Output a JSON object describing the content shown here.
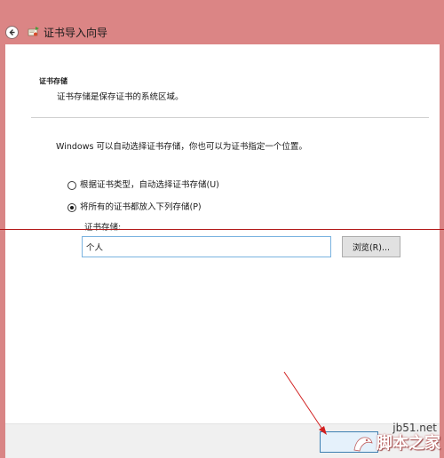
{
  "window": {
    "title": "证书导入向导"
  },
  "section": {
    "title": "证书存储",
    "description": "证书存储是保存证书的系统区域。"
  },
  "info": {
    "text": "Windows 可以自动选择证书存储，你也可以为证书指定一个位置。"
  },
  "options": [
    {
      "label": "根据证书类型，自动选择证书存储(U)",
      "checked": false
    },
    {
      "label": "将所有的证书都放入下列存储(P)",
      "checked": true
    }
  ],
  "store": {
    "label": "证书存储:",
    "value": "个人"
  },
  "buttons": {
    "browse": "浏览(R)..."
  },
  "watermark": {
    "url": "jb51.net",
    "name": "脚本之家"
  },
  "colors": {
    "title_bar": "#db8585",
    "annotation": "#b31a1a",
    "input_border": "#7ab3e0"
  },
  "icons": {
    "back": "back-arrow-icon",
    "wizard": "certificate-wizard-icon",
    "pointer": "red-arrow-annotation"
  }
}
